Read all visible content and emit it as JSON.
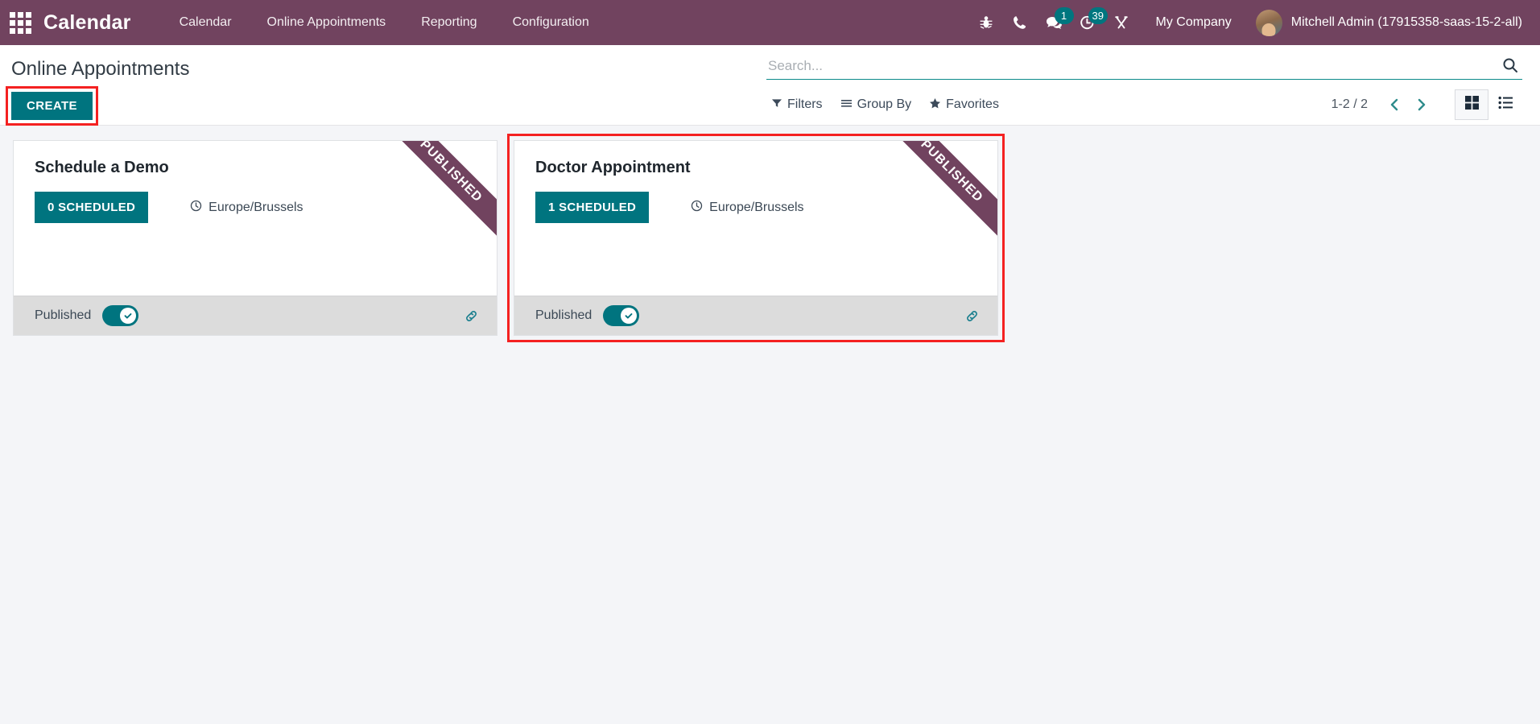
{
  "navbar": {
    "apps_icon": "apps-grid-icon",
    "brand": "Calendar",
    "menu": [
      {
        "label": "Calendar"
      },
      {
        "label": "Online Appointments"
      },
      {
        "label": "Reporting"
      },
      {
        "label": "Configuration"
      }
    ],
    "icons": [
      {
        "name": "bug-icon",
        "badge": null
      },
      {
        "name": "phone-icon",
        "badge": null
      },
      {
        "name": "messages-icon",
        "badge": "1"
      },
      {
        "name": "activity-clock-icon",
        "badge": "39"
      },
      {
        "name": "tools-icon",
        "badge": null
      }
    ],
    "company": "My Company",
    "user": "Mitchell Admin (17915358-saas-15-2-all)",
    "bg_color": "#71435f"
  },
  "control_panel": {
    "title": "Online Appointments",
    "create_label": "CREATE",
    "search": {
      "placeholder": "Search...",
      "value": "",
      "icon": "search-icon"
    },
    "tools": [
      {
        "label": "Filters",
        "icon": "filter-icon"
      },
      {
        "label": "Group By",
        "icon": "list-lines-icon"
      },
      {
        "label": "Favorites",
        "icon": "star-icon"
      }
    ],
    "pager": "1-2 / 2",
    "views": [
      {
        "name": "kanban",
        "icon": "kanban-view-icon",
        "active": true
      },
      {
        "name": "list",
        "icon": "list-view-icon",
        "active": false
      }
    ],
    "accent_color": "#00747f"
  },
  "kanban": {
    "cards": [
      {
        "title": "Schedule a Demo",
        "scheduled": "0 SCHEDULED",
        "timezone": "Europe/Brussels",
        "ribbon": "PUBLISHED",
        "published_label": "Published",
        "published": true,
        "highlighted": false
      },
      {
        "title": "Doctor Appointment",
        "scheduled": "1 SCHEDULED",
        "timezone": "Europe/Brussels",
        "ribbon": "PUBLISHED",
        "published_label": "Published",
        "published": true,
        "highlighted": true
      }
    ],
    "highlight_color": "#f42121"
  }
}
